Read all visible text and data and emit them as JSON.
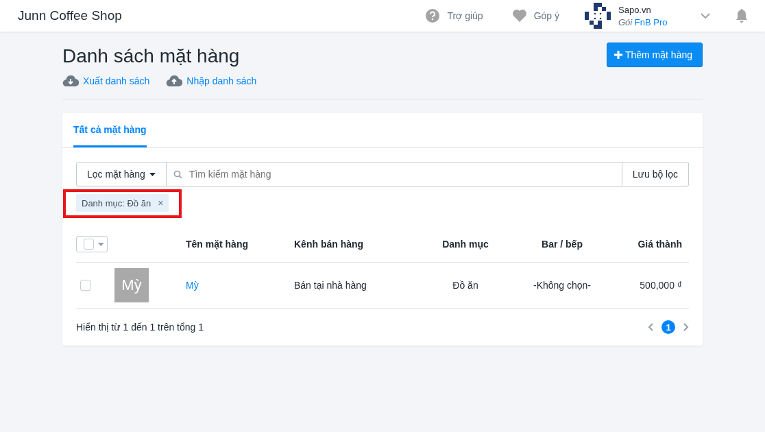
{
  "header": {
    "shop_name": "Junn Coffee Shop",
    "help": "Trợ giúp",
    "feedback": "Góp ý",
    "account": {
      "name": "Sapo.vn",
      "plan_prefix": "Gói",
      "plan": "FnB Pro"
    }
  },
  "page": {
    "title": "Danh sách mặt hàng",
    "add_button": "Thêm mặt hàng",
    "export": "Xuất danh sách",
    "import": "Nhập danh sách"
  },
  "tabs": [
    {
      "label": "Tất cả mặt hàng",
      "selected": true
    }
  ],
  "filter": {
    "filter_button": "Lọc mặt hàng",
    "search_placeholder": "Tìm kiếm mặt hàng",
    "save_button": "Lưu bộ lọc",
    "chips": [
      {
        "label": "Danh mục: Đồ ăn",
        "remove": "×",
        "highlighted": true
      }
    ]
  },
  "table": {
    "select_all_checked": false,
    "columns": [
      "Tên mặt hàng",
      "Kênh bán hàng",
      "Danh mục",
      "Bar / bếp",
      "Giá thành"
    ],
    "rows": [
      {
        "checked": false,
        "thumbnail": "Mỳ",
        "name": "Mỳ",
        "channel": "Bán tại nhà hàng",
        "category": "Đồ ăn",
        "station": "-Không chọn-",
        "price": "500,000 ₫"
      }
    ]
  },
  "footer": {
    "summary": "Hiển thị từ 1 đến 1 trên tổng 1",
    "pages": [
      {
        "label": "1",
        "selected": true
      }
    ]
  }
}
